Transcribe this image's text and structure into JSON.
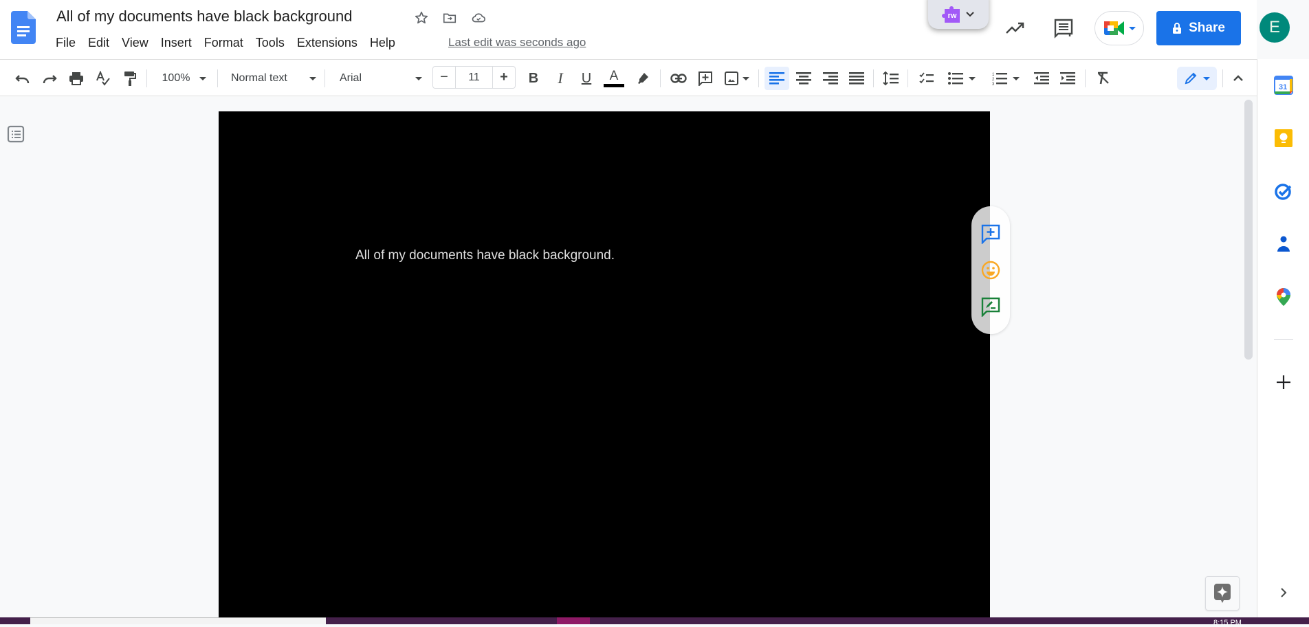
{
  "app": {
    "title": "All of my documents have black background",
    "last_edit": "Last edit was seconds ago",
    "brand_color": "#1a73e8"
  },
  "menu": [
    "File",
    "Edit",
    "View",
    "Insert",
    "Format",
    "Tools",
    "Extensions",
    "Help"
  ],
  "header_right": {
    "extension_label": "rw",
    "share_label": "Share",
    "avatar_letter": "E"
  },
  "toolbar": {
    "zoom": "100%",
    "style": "Normal text",
    "font": "Arial",
    "font_size": "11",
    "minus": "−",
    "plus": "+"
  },
  "document": {
    "text": "All of my documents have black background.",
    "page_color": "#000000",
    "text_color": "#e0e0e0"
  },
  "side_panel": {
    "calendar_day": "31"
  },
  "taskbar": {
    "time": "8:15 PM"
  }
}
